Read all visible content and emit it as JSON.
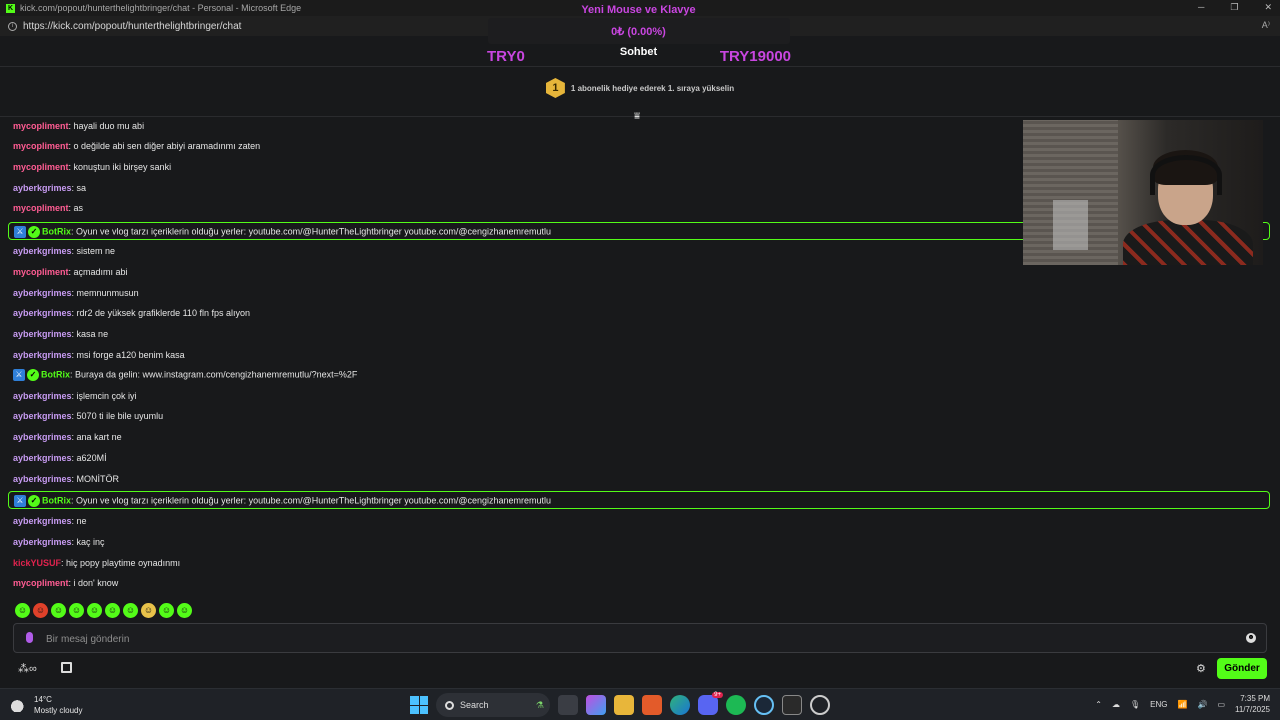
{
  "browser": {
    "title": "kick.com/popout/hunterthelightbringer/chat - Personal - Microsoft Edge",
    "url": "https://kick.com/popout/hunterthelightbringer/chat",
    "favicon_letter": "K"
  },
  "goal": {
    "title": "Yeni Mouse ve Klavye",
    "progress": "0₺ (0.00%)",
    "progress_fraction": 0.0,
    "min_label": "TRY0",
    "max_label": "TRY19000"
  },
  "chat": {
    "heading": "Sohbet",
    "subgift_rank": "1",
    "subgift_text": "1 abonelik hediye ederek 1. sıraya yükselin",
    "messages": [
      {
        "user": "mycopliment",
        "color": "#ff5c93",
        "text": ": hayali duo mu abi",
        "bot": false
      },
      {
        "user": "mycopliment",
        "color": "#ff5c93",
        "text": ": o değilde abi sen diğer abiyi aramadınmı zaten",
        "bot": false
      },
      {
        "user": "mycopliment",
        "color": "#ff5c93",
        "text": ": konuştun iki birşey sanki",
        "bot": false
      },
      {
        "user": "ayberkgrimes",
        "color": "#c79bf2",
        "text": ": sa",
        "bot": false
      },
      {
        "user": "mycopliment",
        "color": "#ff5c93",
        "text": ": as",
        "bot": false
      },
      {
        "user": "BotRix",
        "color": "#53fc18",
        "text": ": Oyun ve vlog tarzı içeriklerin olduğu yerler: youtube.com/@HunterTheLightbringer youtube.com/@cengizhanemremutlu",
        "bot": true,
        "highlight": true
      },
      {
        "user": "ayberkgrimes",
        "color": "#c79bf2",
        "text": ": sistem ne",
        "bot": false
      },
      {
        "user": "mycopliment",
        "color": "#ff5c93",
        "text": ": açmadımı abi",
        "bot": false
      },
      {
        "user": "ayberkgrimes",
        "color": "#c79bf2",
        "text": ": memnunmusun",
        "bot": false
      },
      {
        "user": "ayberkgrimes",
        "color": "#c79bf2",
        "text": ": rdr2 de yüksek grafiklerde 110 fln fps alıyon",
        "bot": false
      },
      {
        "user": "ayberkgrimes",
        "color": "#c79bf2",
        "text": ": kasa ne",
        "bot": false
      },
      {
        "user": "ayberkgrimes",
        "color": "#c79bf2",
        "text": ": msi forge a120 benim kasa",
        "bot": false
      },
      {
        "user": "BotRix",
        "color": "#53fc18",
        "text": ": Buraya da gelin: www.instagram.com/cengizhanemremutlu/?next=%2F",
        "bot": true,
        "highlight": false
      },
      {
        "user": "ayberkgrimes",
        "color": "#c79bf2",
        "text": ": işlemcin çok iyi",
        "bot": false
      },
      {
        "user": "ayberkgrimes",
        "color": "#c79bf2",
        "text": ": 5070 ti ile bile uyumlu",
        "bot": false
      },
      {
        "user": "ayberkgrimes",
        "color": "#c79bf2",
        "text": ": ana kart ne",
        "bot": false
      },
      {
        "user": "ayberkgrimes",
        "color": "#c79bf2",
        "text": ": a620Mİ",
        "bot": false
      },
      {
        "user": "ayberkgrimes",
        "color": "#c79bf2",
        "text": ": MONİTÖR",
        "bot": false
      },
      {
        "user": "BotRix",
        "color": "#53fc18",
        "text": ": Oyun ve vlog tarzı içeriklerin olduğu yerler: youtube.com/@HunterTheLightbringer youtube.com/@cengizhanemremutlu",
        "bot": true,
        "highlight": true
      },
      {
        "user": "ayberkgrimes",
        "color": "#c79bf2",
        "text": ": ne",
        "bot": false
      },
      {
        "user": "ayberkgrimes",
        "color": "#c79bf2",
        "text": ": kaç inç",
        "bot": false
      },
      {
        "user": "kickYUSUF",
        "color": "#e0234e",
        "text": ": hiç popy playtime oynadınmı",
        "bot": false
      },
      {
        "user": "mycopliment",
        "color": "#ff5c93",
        "text": ": i don' know",
        "bot": false
      }
    ],
    "emotes": [
      "#53fc18",
      "#e0412a",
      "#53fc18",
      "#53fc18",
      "#53fc18",
      "#53fc18",
      "#53fc18",
      "#e8c24a",
      "#53fc18",
      "#53fc18"
    ],
    "input_placeholder": "Bir mesaj gönderin",
    "send_label": "Gönder"
  },
  "taskbar": {
    "weather_temp": "14°C",
    "weather_desc": "Mostly cloudy",
    "search_label": "Search",
    "lang": "ENG",
    "time": "7:35 PM",
    "date": "11/7/2025",
    "discord_badge": "9+"
  },
  "colors": {
    "accent": "#53fc18",
    "goal": "#c946e0",
    "background": "#18191b"
  }
}
